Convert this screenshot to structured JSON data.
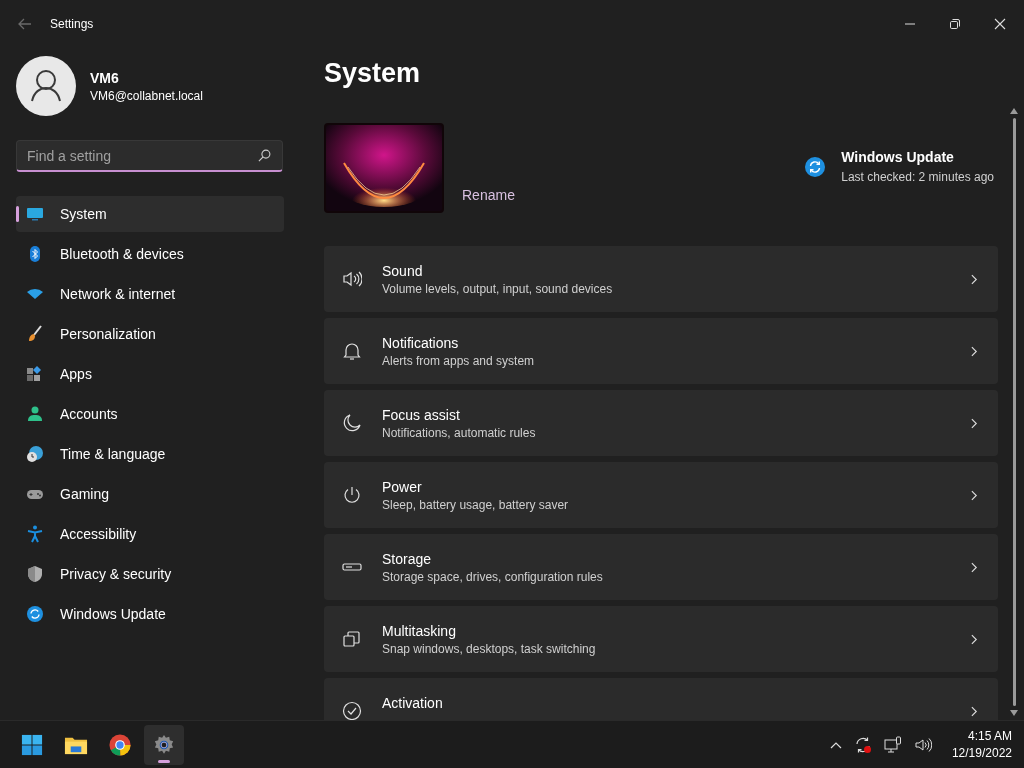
{
  "window": {
    "title": "Settings"
  },
  "profile": {
    "name": "VM6",
    "email": "VM6@collabnet.local"
  },
  "search": {
    "placeholder": "Find a setting"
  },
  "sidebar": {
    "items": [
      {
        "label": "System",
        "selected": true
      },
      {
        "label": "Bluetooth & devices",
        "selected": false
      },
      {
        "label": "Network & internet",
        "selected": false
      },
      {
        "label": "Personalization",
        "selected": false
      },
      {
        "label": "Apps",
        "selected": false
      },
      {
        "label": "Accounts",
        "selected": false
      },
      {
        "label": "Time & language",
        "selected": false
      },
      {
        "label": "Gaming",
        "selected": false
      },
      {
        "label": "Accessibility",
        "selected": false
      },
      {
        "label": "Privacy & security",
        "selected": false
      },
      {
        "label": "Windows Update",
        "selected": false
      }
    ]
  },
  "page": {
    "title": "System",
    "rename": "Rename",
    "update": {
      "title": "Windows Update",
      "status": "Last checked: 2 minutes ago"
    }
  },
  "cards": [
    {
      "title": "Sound",
      "subtitle": "Volume levels, output, input, sound devices"
    },
    {
      "title": "Notifications",
      "subtitle": "Alerts from apps and system"
    },
    {
      "title": "Focus assist",
      "subtitle": "Notifications, automatic rules"
    },
    {
      "title": "Power",
      "subtitle": "Sleep, battery usage, battery saver"
    },
    {
      "title": "Storage",
      "subtitle": "Storage space, drives, configuration rules"
    },
    {
      "title": "Multitasking",
      "subtitle": "Snap windows, desktops, task switching"
    },
    {
      "title": "Activation"
    }
  ],
  "taskbar": {
    "apps": [
      {
        "selected": false
      },
      {
        "selected": false
      },
      {
        "selected": false
      },
      {
        "selected": true
      }
    ],
    "time": "4:15 AM",
    "date": "12/19/2022"
  }
}
